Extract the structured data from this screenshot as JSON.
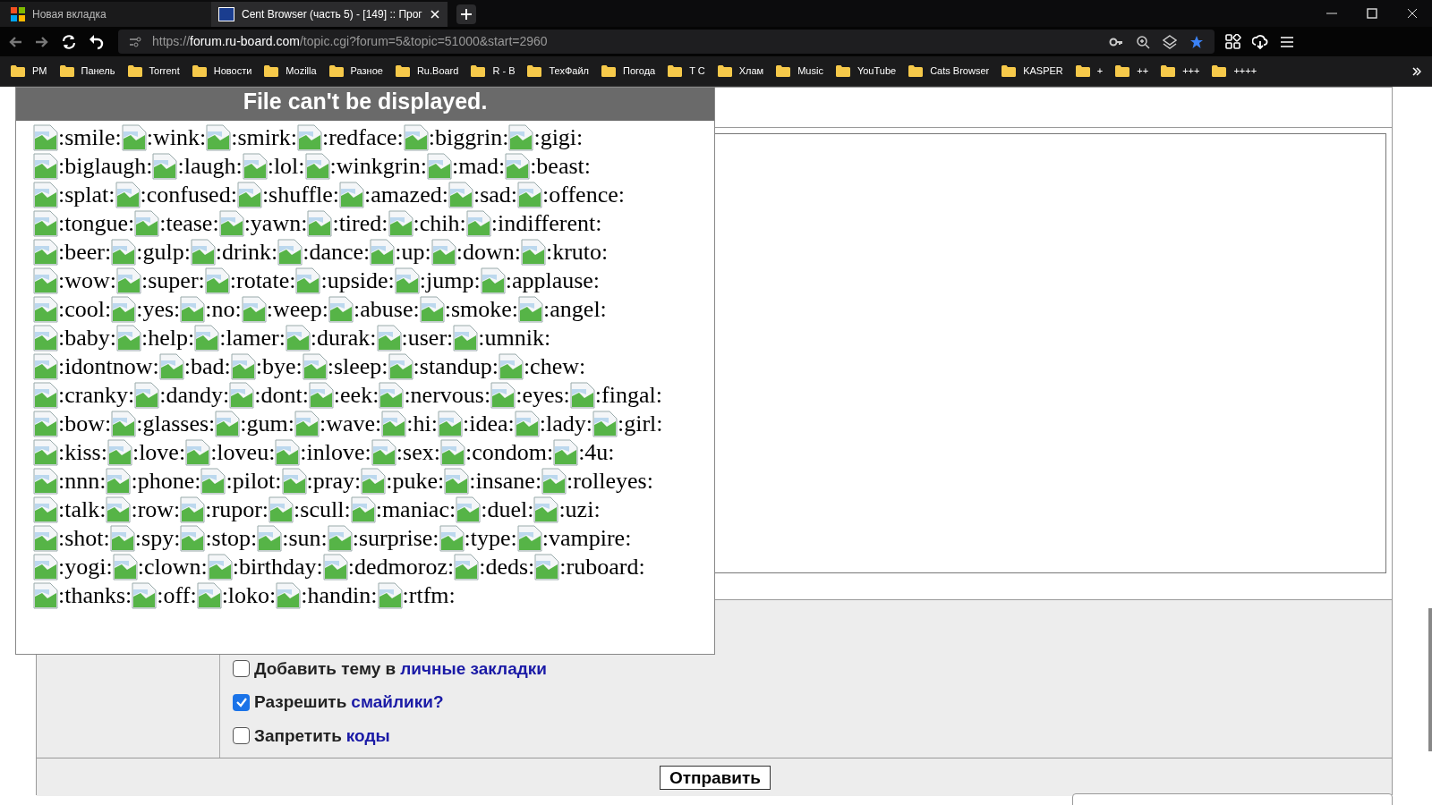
{
  "tabs": [
    {
      "title": "Новая вкладка",
      "selected": false
    },
    {
      "title": "Cent Browser (часть 5) - [149] :: Прог",
      "selected": true
    }
  ],
  "address": {
    "scheme": "https://",
    "host": "forum.ru-board.com",
    "path": "/topic.cgi?forum=5&topic=51000&start=2960"
  },
  "bookmarks": [
    "PM",
    "Панель",
    "Torrent",
    "Новости",
    "Mozilla",
    "Разное",
    "Ru.Board",
    "R - B",
    "ТехФайл",
    "Погода",
    "T C",
    "Хлам",
    "Music",
    "YouTube",
    "Cats Browser",
    "KASPER",
    "+",
    "++",
    "+++",
    "++++"
  ],
  "popup": {
    "title": "File can't be displayed.",
    "lines": [
      [
        ":smile:",
        ":wink:",
        ":smirk:",
        ":redface:",
        ":biggrin:",
        ":gigi:"
      ],
      [
        ":biglaugh:",
        ":laugh:",
        ":lol:",
        ":winkgrin:",
        ":mad:",
        ":beast:"
      ],
      [
        ":splat:",
        ":confused:",
        ":shuffle:",
        ":amazed:",
        ":sad:",
        ":offence:"
      ],
      [
        ":tongue:",
        ":tease:",
        ":yawn:",
        ":tired:",
        ":chih:",
        ":indifferent:"
      ],
      [
        ":beer:",
        ":gulp:",
        ":drink:",
        ":dance:",
        ":up:",
        ":down:",
        ":kruto:"
      ],
      [
        ":wow:",
        ":super:",
        ":rotate:",
        ":upside:",
        ":jump:",
        ":applause:"
      ],
      [
        ":cool:",
        ":yes:",
        ":no:",
        ":weep:",
        ":abuse:",
        ":smoke:",
        ":angel:"
      ],
      [
        ":baby:",
        ":help:",
        ":lamer:",
        ":durak:",
        ":user:",
        ":umnik:"
      ],
      [
        ":idontnow:",
        ":bad:",
        ":bye:",
        ":sleep:",
        ":standup:",
        ":chew:"
      ],
      [
        ":cranky:",
        ":dandy:",
        ":dont:",
        ":eek:",
        ":nervous:",
        ":eyes:",
        ":fingal:"
      ],
      [
        ":bow:",
        ":glasses:",
        ":gum:",
        ":wave:",
        ":hi:",
        ":idea:",
        ":lady:",
        ":girl:"
      ],
      [
        ":kiss:",
        ":love:",
        ":loveu:",
        ":inlove:",
        ":sex:",
        ":condom:",
        ":4u:"
      ],
      [
        ":nnn:",
        ":phone:",
        ":pilot:",
        ":pray:",
        ":puke:",
        ":insane:",
        ":rolleyes:"
      ],
      [
        ":talk:",
        ":row:",
        ":rupor:",
        ":scull:",
        ":maniac:",
        ":duel:",
        ":uzi:"
      ],
      [
        ":shot:",
        ":spy:",
        ":stop:",
        ":sun:",
        ":surprise:",
        ":type:",
        ":vampire:"
      ],
      [
        ":yogi:",
        ":clown:",
        ":birthday:",
        ":dedmoroz:",
        ":deds:",
        ":ruboard:"
      ],
      [
        ":thanks:",
        ":off:",
        ":loko:",
        ":handin:",
        ":rtfm:"
      ]
    ]
  },
  "options": [
    {
      "label": "Добавить тему в",
      "link": "личные закладки",
      "checked": false
    },
    {
      "label": "Разрешить",
      "link": "смайлики?",
      "checked": true
    },
    {
      "label": "Запретить",
      "link": "коды",
      "checked": false
    }
  ],
  "submit": "Отправить"
}
